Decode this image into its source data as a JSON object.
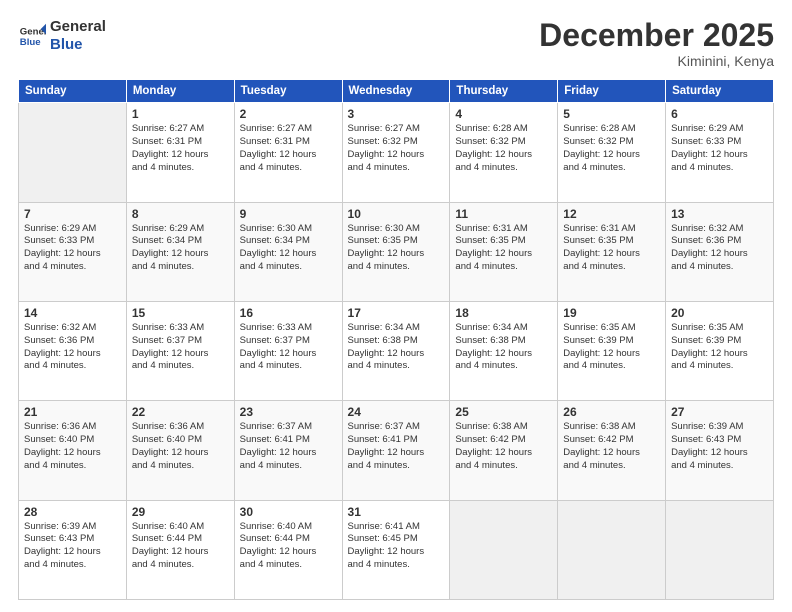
{
  "logo": {
    "line1": "General",
    "line2": "Blue"
  },
  "title": "December 2025",
  "location": "Kiminini, Kenya",
  "header_days": [
    "Sunday",
    "Monday",
    "Tuesday",
    "Wednesday",
    "Thursday",
    "Friday",
    "Saturday"
  ],
  "weeks": [
    [
      {
        "day": "",
        "info": ""
      },
      {
        "day": "1",
        "info": "Sunrise: 6:27 AM\nSunset: 6:31 PM\nDaylight: 12 hours\nand 4 minutes."
      },
      {
        "day": "2",
        "info": "Sunrise: 6:27 AM\nSunset: 6:31 PM\nDaylight: 12 hours\nand 4 minutes."
      },
      {
        "day": "3",
        "info": "Sunrise: 6:27 AM\nSunset: 6:32 PM\nDaylight: 12 hours\nand 4 minutes."
      },
      {
        "day": "4",
        "info": "Sunrise: 6:28 AM\nSunset: 6:32 PM\nDaylight: 12 hours\nand 4 minutes."
      },
      {
        "day": "5",
        "info": "Sunrise: 6:28 AM\nSunset: 6:32 PM\nDaylight: 12 hours\nand 4 minutes."
      },
      {
        "day": "6",
        "info": "Sunrise: 6:29 AM\nSunset: 6:33 PM\nDaylight: 12 hours\nand 4 minutes."
      }
    ],
    [
      {
        "day": "7",
        "info": "Sunrise: 6:29 AM\nSunset: 6:33 PM\nDaylight: 12 hours\nand 4 minutes."
      },
      {
        "day": "8",
        "info": "Sunrise: 6:29 AM\nSunset: 6:34 PM\nDaylight: 12 hours\nand 4 minutes."
      },
      {
        "day": "9",
        "info": "Sunrise: 6:30 AM\nSunset: 6:34 PM\nDaylight: 12 hours\nand 4 minutes."
      },
      {
        "day": "10",
        "info": "Sunrise: 6:30 AM\nSunset: 6:35 PM\nDaylight: 12 hours\nand 4 minutes."
      },
      {
        "day": "11",
        "info": "Sunrise: 6:31 AM\nSunset: 6:35 PM\nDaylight: 12 hours\nand 4 minutes."
      },
      {
        "day": "12",
        "info": "Sunrise: 6:31 AM\nSunset: 6:35 PM\nDaylight: 12 hours\nand 4 minutes."
      },
      {
        "day": "13",
        "info": "Sunrise: 6:32 AM\nSunset: 6:36 PM\nDaylight: 12 hours\nand 4 minutes."
      }
    ],
    [
      {
        "day": "14",
        "info": "Sunrise: 6:32 AM\nSunset: 6:36 PM\nDaylight: 12 hours\nand 4 minutes."
      },
      {
        "day": "15",
        "info": "Sunrise: 6:33 AM\nSunset: 6:37 PM\nDaylight: 12 hours\nand 4 minutes."
      },
      {
        "day": "16",
        "info": "Sunrise: 6:33 AM\nSunset: 6:37 PM\nDaylight: 12 hours\nand 4 minutes."
      },
      {
        "day": "17",
        "info": "Sunrise: 6:34 AM\nSunset: 6:38 PM\nDaylight: 12 hours\nand 4 minutes."
      },
      {
        "day": "18",
        "info": "Sunrise: 6:34 AM\nSunset: 6:38 PM\nDaylight: 12 hours\nand 4 minutes."
      },
      {
        "day": "19",
        "info": "Sunrise: 6:35 AM\nSunset: 6:39 PM\nDaylight: 12 hours\nand 4 minutes."
      },
      {
        "day": "20",
        "info": "Sunrise: 6:35 AM\nSunset: 6:39 PM\nDaylight: 12 hours\nand 4 minutes."
      }
    ],
    [
      {
        "day": "21",
        "info": "Sunrise: 6:36 AM\nSunset: 6:40 PM\nDaylight: 12 hours\nand 4 minutes."
      },
      {
        "day": "22",
        "info": "Sunrise: 6:36 AM\nSunset: 6:40 PM\nDaylight: 12 hours\nand 4 minutes."
      },
      {
        "day": "23",
        "info": "Sunrise: 6:37 AM\nSunset: 6:41 PM\nDaylight: 12 hours\nand 4 minutes."
      },
      {
        "day": "24",
        "info": "Sunrise: 6:37 AM\nSunset: 6:41 PM\nDaylight: 12 hours\nand 4 minutes."
      },
      {
        "day": "25",
        "info": "Sunrise: 6:38 AM\nSunset: 6:42 PM\nDaylight: 12 hours\nand 4 minutes."
      },
      {
        "day": "26",
        "info": "Sunrise: 6:38 AM\nSunset: 6:42 PM\nDaylight: 12 hours\nand 4 minutes."
      },
      {
        "day": "27",
        "info": "Sunrise: 6:39 AM\nSunset: 6:43 PM\nDaylight: 12 hours\nand 4 minutes."
      }
    ],
    [
      {
        "day": "28",
        "info": "Sunrise: 6:39 AM\nSunset: 6:43 PM\nDaylight: 12 hours\nand 4 minutes."
      },
      {
        "day": "29",
        "info": "Sunrise: 6:40 AM\nSunset: 6:44 PM\nDaylight: 12 hours\nand 4 minutes."
      },
      {
        "day": "30",
        "info": "Sunrise: 6:40 AM\nSunset: 6:44 PM\nDaylight: 12 hours\nand 4 minutes."
      },
      {
        "day": "31",
        "info": "Sunrise: 6:41 AM\nSunset: 6:45 PM\nDaylight: 12 hours\nand 4 minutes."
      },
      {
        "day": "",
        "info": ""
      },
      {
        "day": "",
        "info": ""
      },
      {
        "day": "",
        "info": ""
      }
    ]
  ]
}
